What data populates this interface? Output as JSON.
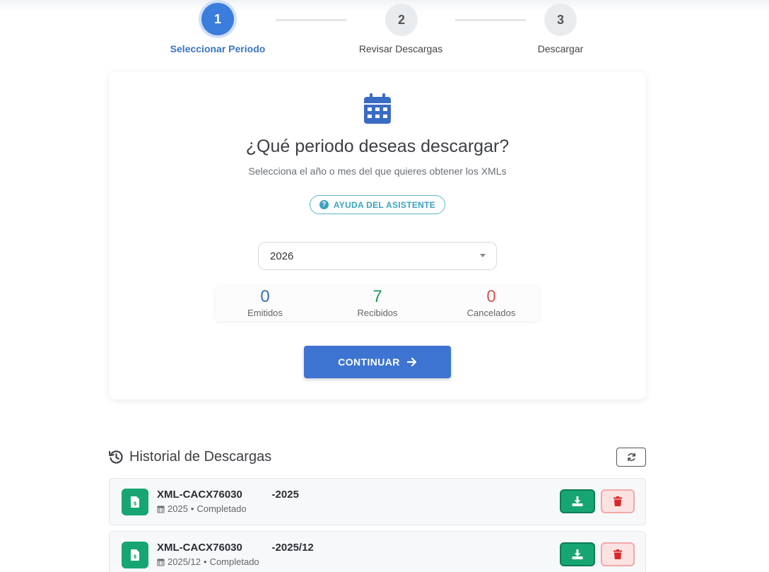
{
  "stepper": {
    "steps": [
      {
        "number": "1",
        "label": "Seleccionar Periodo",
        "state": "active"
      },
      {
        "number": "2",
        "label": "Revisar Descargas",
        "state": "inactive"
      },
      {
        "number": "3",
        "label": "Descargar",
        "state": "inactive"
      }
    ]
  },
  "period_card": {
    "icon": "calendar-icon",
    "title": "¿Qué periodo deseas descargar?",
    "subtitle": "Selecciona el año o mes del que quieres obtener los XMLs",
    "help_label": "AYUDA DEL ASISTENTE",
    "year_select": {
      "value": "2026"
    },
    "stats": [
      {
        "value": "0",
        "label": "Emitidos",
        "color": "#3b6fb6"
      },
      {
        "value": "7",
        "label": "Recibidos",
        "color": "#1a9b5a"
      },
      {
        "value": "0",
        "label": "Cancelados",
        "color": "#d9534f"
      }
    ],
    "continue_label": "CONTINUAR"
  },
  "history": {
    "title": "Historial de Descargas",
    "items": [
      {
        "name": "XML-CACX76030          -2025",
        "period": "2025",
        "status": "Completado"
      },
      {
        "name": "XML-CACX76030          -2025/12",
        "period": "2025/12",
        "status": "Completado"
      }
    ]
  },
  "colors": {
    "primary": "#3d74d2",
    "success": "#17a673",
    "danger": "#dc2626",
    "info": "#3aa2c0"
  }
}
